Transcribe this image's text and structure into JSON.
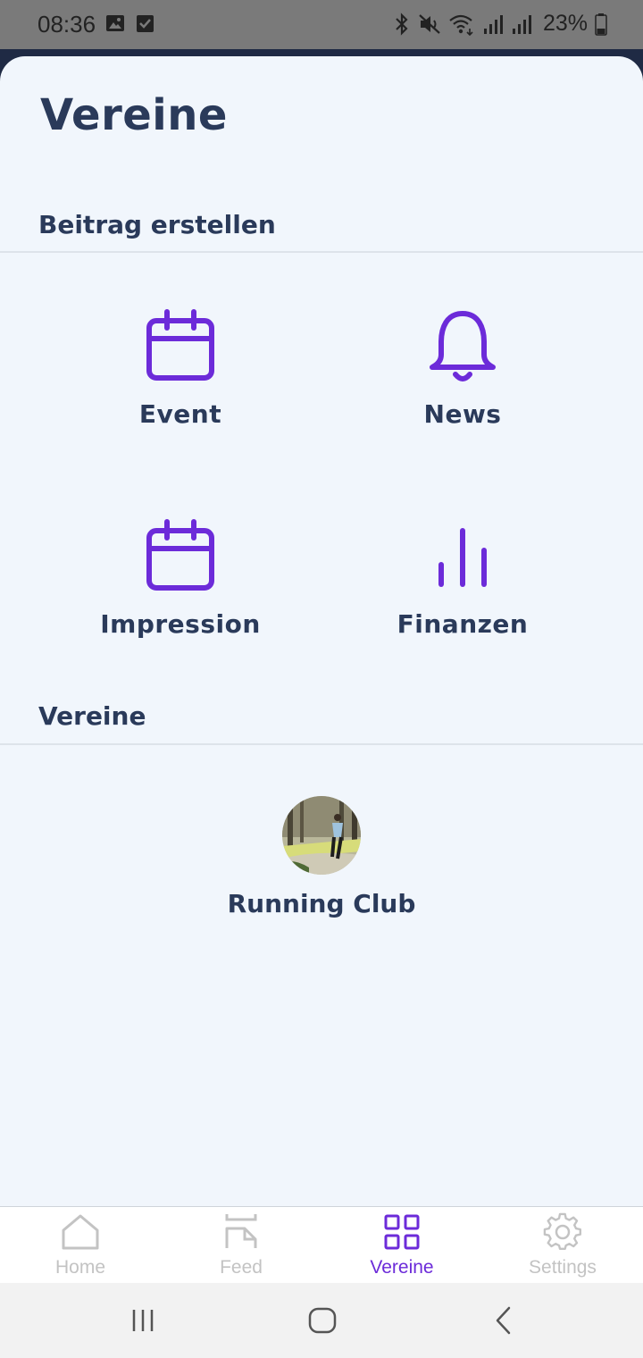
{
  "status_bar": {
    "time": "08:36",
    "battery": "23%",
    "icons": [
      "image-icon",
      "check-box-icon",
      "bluetooth-icon",
      "mute-icon",
      "wifi-icon",
      "signal-icon",
      "signal-icon",
      "battery-icon"
    ]
  },
  "page": {
    "title": "Vereine"
  },
  "create_section": {
    "title": "Beitrag erstellen",
    "actions": [
      {
        "label": "Event",
        "icon": "calendar-icon"
      },
      {
        "label": "News",
        "icon": "bell-icon"
      },
      {
        "label": "Impression",
        "icon": "calendar-icon"
      },
      {
        "label": "Finanzen",
        "icon": "bar-chart-icon"
      }
    ]
  },
  "clubs_section": {
    "title": "Vereine",
    "clubs": [
      {
        "name": "Running Club",
        "icon": "club-avatar"
      }
    ]
  },
  "bottom_nav": {
    "items": [
      {
        "label": "Home",
        "icon": "home-icon",
        "active": false
      },
      {
        "label": "Feed",
        "icon": "feed-icon",
        "active": false
      },
      {
        "label": "Vereine",
        "icon": "grid-icon",
        "active": true
      },
      {
        "label": "Settings",
        "icon": "gear-icon",
        "active": false
      }
    ]
  },
  "colors": {
    "accent": "#6c2bd9",
    "text": "#2a3a5a",
    "background": "#f1f6fc",
    "inactive": "#c3c3c3"
  }
}
